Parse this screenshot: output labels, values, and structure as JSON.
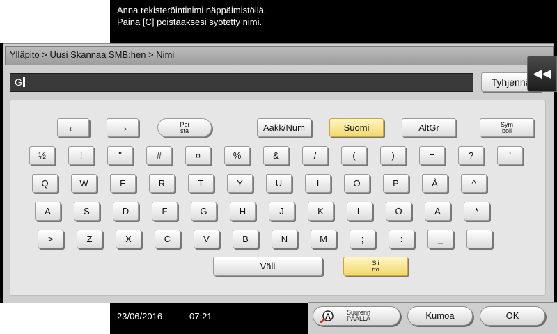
{
  "message": {
    "line1": "Anna rekisteröintinimi näppäimistöllä.",
    "line2": "Paina [C] poistaaksesi syötetty nimi."
  },
  "breadcrumb": "Ylläpito > Uusi Skannaa SMB:hen > Nimi",
  "input": {
    "value": "G"
  },
  "clear_label": "Tyhjennä",
  "collapse_glyph": "◀◀",
  "keyboard": {
    "top": {
      "left_arrow": "←",
      "right_arrow": "→",
      "delete_line1": "Poi",
      "delete_line2": "sta",
      "mode_label": "Aakk/Num",
      "lang_label": "Suomi",
      "altgr_label": "AltGr",
      "symbol_line1": "Sym",
      "symbol_line2": "boli"
    },
    "row1": [
      "½",
      "!",
      "\"",
      "#",
      "¤",
      "%",
      "&",
      "/",
      "(",
      ")",
      "=",
      "?",
      "`"
    ],
    "row2": [
      "Q",
      "W",
      "E",
      "R",
      "T",
      "Y",
      "U",
      "I",
      "O",
      "P",
      "Å",
      "^"
    ],
    "row3": [
      "A",
      "S",
      "D",
      "F",
      "G",
      "H",
      "J",
      "K",
      "L",
      "Ö",
      "Ä",
      "*"
    ],
    "row4": [
      ">",
      "Z",
      "X",
      "C",
      "V",
      "B",
      "N",
      "M",
      ";",
      ":",
      "_",
      ""
    ],
    "space_label": "Väli",
    "shift_line1": "Sii",
    "shift_line2": "rto"
  },
  "status": {
    "date": "23/06/2016",
    "time": "07:21"
  },
  "bottom": {
    "zoom_line1": "Suurenn",
    "zoom_line2": "PÄÄLLÄ",
    "zoom_icon_text": "A",
    "cancel_label": "Kumoa",
    "ok_label": "OK"
  },
  "colors": {
    "accent_yellow": "#f2d86b",
    "panel_gray": "#cfcfcf",
    "input_dark": "#3a3a3a"
  }
}
